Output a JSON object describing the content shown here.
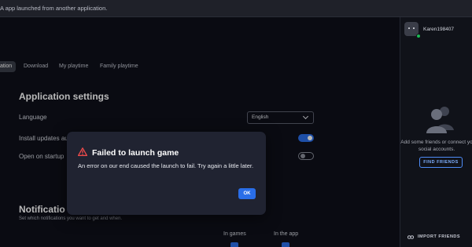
{
  "topbar": {
    "message": "A app launched from another application."
  },
  "tabs": [
    {
      "label": "ation",
      "active": true
    },
    {
      "label": "Download",
      "active": false
    },
    {
      "label": "My playtime",
      "active": false
    },
    {
      "label": "Family playtime",
      "active": false
    }
  ],
  "settings": {
    "title": "Application settings",
    "language_label": "Language",
    "language_value": "English",
    "install_updates_label": "Install updates au",
    "install_updates_on": true,
    "open_on_startup_label": "Open on startup",
    "open_on_startup_on": false
  },
  "notifications": {
    "title": "Notificatio",
    "subtitle": "Set which notifications you want to get and when.",
    "col_in_games": "In games",
    "col_in_app": "In the app"
  },
  "sidebar": {
    "username": "Karen198407",
    "status": "online",
    "empty_text": "Add some friends or connect yo social accounts.",
    "find_friends_label": "FIND FRIENDS",
    "import_friends_label": "IMPORT FRIENDS"
  },
  "dialog": {
    "title": "Failed to launch game",
    "body": "An error on our end caused the launch to fail. Try again a little later.",
    "ok_label": "OK",
    "warning_icon": "warning-triangle-icon"
  },
  "colors": {
    "accent": "#2a6ee8",
    "warning": "#ef4b4b",
    "online": "#1db954"
  }
}
